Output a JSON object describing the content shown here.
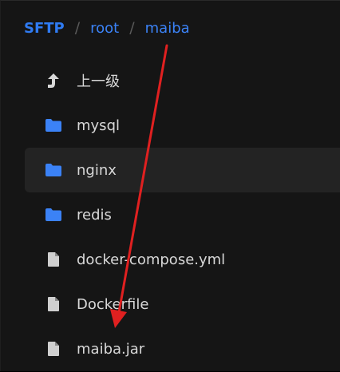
{
  "breadcrumb": {
    "root": "SFTP",
    "separator": "/",
    "segments": [
      "root",
      "maiba"
    ]
  },
  "colors": {
    "accent": "#3b82f6",
    "folder": "#3b82f6",
    "file": "#cfcfcf",
    "annotation_arrow": "#e02020"
  },
  "files": [
    {
      "name": "上一级",
      "icon": "parent-arrow-icon",
      "type": "parent"
    },
    {
      "name": "mysql",
      "icon": "folder-icon",
      "type": "folder"
    },
    {
      "name": "nginx",
      "icon": "folder-icon",
      "type": "folder",
      "hovered": true
    },
    {
      "name": "redis",
      "icon": "folder-icon",
      "type": "folder"
    },
    {
      "name": "docker-compose.yml",
      "icon": "file-icon",
      "type": "file"
    },
    {
      "name": "Dockerfile",
      "icon": "file-icon",
      "type": "file"
    },
    {
      "name": "maiba.jar",
      "icon": "file-icon",
      "type": "file"
    }
  ]
}
